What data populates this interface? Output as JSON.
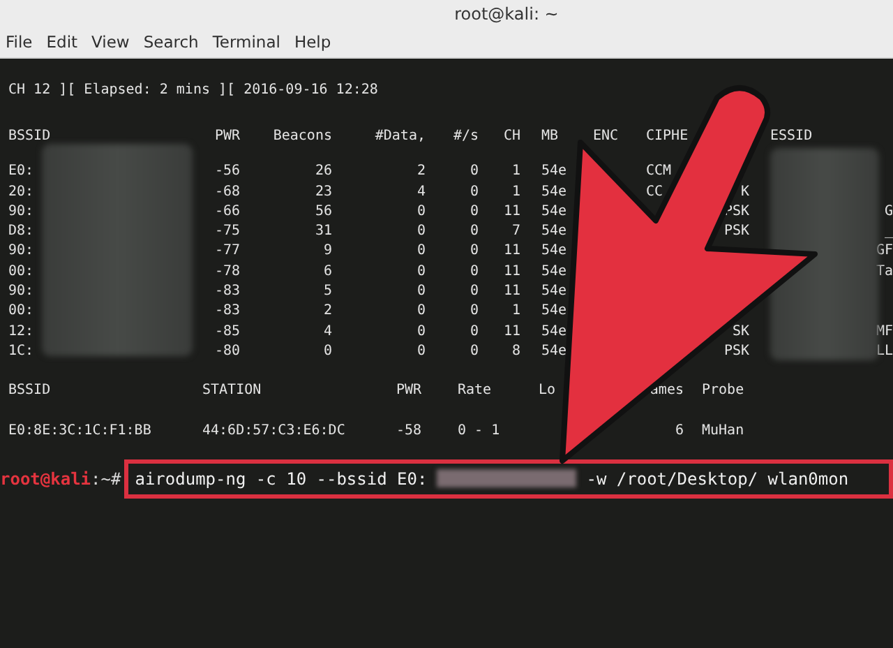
{
  "window": {
    "title": "root@kali: ~"
  },
  "menu": [
    "File",
    "Edit",
    "View",
    "Search",
    "Terminal",
    "Help"
  ],
  "terminal": {
    "status_line": "CH 12 ][ Elapsed: 2 mins ][ 2016-09-16 12:28",
    "ap_table": {
      "headers": {
        "bssid": "BSSID",
        "pwr": "PWR",
        "beacons": "Beacons",
        "data": "#Data,",
        "per_sec": "#/s",
        "ch": "CH",
        "mb": "MB",
        "enc": "ENC",
        "cipher": "CIPHE",
        "essid": "ESSID"
      },
      "rows": [
        {
          "bssid": "E0:",
          "pwr": "-56",
          "beacons": "26",
          "data": "2",
          "per_sec": "0",
          "ch": "1",
          "mb": "54e",
          "cipher": "CCM"
        },
        {
          "bssid": "20:",
          "pwr": "-68",
          "beacons": "23",
          "data": "4",
          "per_sec": "0",
          "ch": "1",
          "mb": "54e",
          "cipher": "CC",
          "auth": "K"
        },
        {
          "bssid": "90:",
          "pwr": "-66",
          "beacons": "56",
          "data": "0",
          "per_sec": "0",
          "ch": "11",
          "mb": "54e",
          "auth": "PSK",
          "essid_tail": "G"
        },
        {
          "bssid": "D8:",
          "pwr": "-75",
          "beacons": "31",
          "data": "0",
          "per_sec": "0",
          "ch": "7",
          "mb": "54e",
          "auth": "PSK",
          "essid_tail": "_"
        },
        {
          "bssid": "90:",
          "pwr": "-77",
          "beacons": "9",
          "data": "0",
          "per_sec": "0",
          "ch": "11",
          "mb": "54e",
          "essid_tail": "GF"
        },
        {
          "bssid": "00:",
          "pwr": "-78",
          "beacons": "6",
          "data": "0",
          "per_sec": "0",
          "ch": "11",
          "mb": "54e",
          "essid_tail": "Ta"
        },
        {
          "bssid": "90:",
          "pwr": "-83",
          "beacons": "5",
          "data": "0",
          "per_sec": "0",
          "ch": "11",
          "mb": "54e"
        },
        {
          "bssid": "00:",
          "pwr": "-83",
          "beacons": "2",
          "data": "0",
          "per_sec": "0",
          "ch": "1",
          "mb": "54e"
        },
        {
          "bssid": "12:",
          "pwr": "-85",
          "beacons": "4",
          "data": "0",
          "per_sec": "0",
          "ch": "11",
          "mb": "54e",
          "auth": "SK",
          "essid_tail": "MF"
        },
        {
          "bssid": "1C:",
          "pwr": "-80",
          "beacons": "0",
          "data": "0",
          "per_sec": "0",
          "ch": "8",
          "mb": "54e",
          "auth": "PSK",
          "essid_tail": "LL"
        }
      ]
    },
    "station_table": {
      "headers": {
        "bssid": "BSSID",
        "station": "STATION",
        "pwr": "PWR",
        "rate": "Rate",
        "lost": "Lo",
        "frames": "ames",
        "probe": "Probe"
      },
      "rows": [
        {
          "bssid": "E0:8E:3C:1C:F1:BB",
          "station": "44:6D:57:C3:E6:DC",
          "pwr": "-58",
          "rate": "0 - 1",
          "frames": "6",
          "probe": "MuHan"
        }
      ]
    },
    "prompt": {
      "user": "root@kali",
      "path": ":~#",
      "command_before": "airodump-ng -c 10 --bssid E0:",
      "command_after": "-w /root/Desktop/ wlan0mon"
    }
  }
}
